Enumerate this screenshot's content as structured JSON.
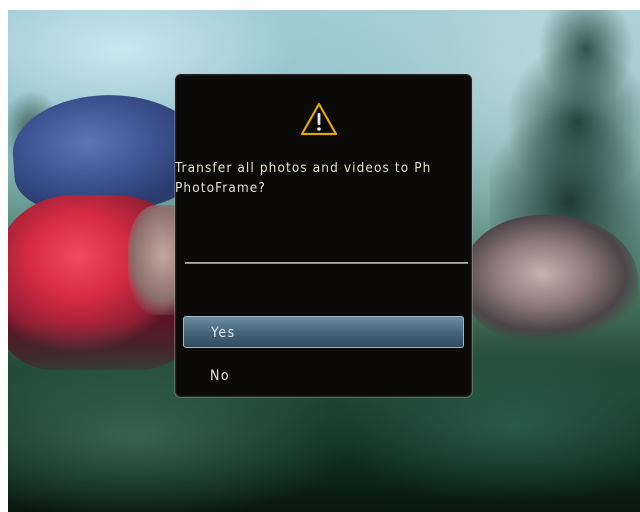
{
  "dialog": {
    "icon": "warning-icon",
    "message_line1": "Transfer all photos and videos to Ph",
    "message_line2": "PhotoFrame?",
    "options": [
      {
        "label": "Yes",
        "selected": true
      },
      {
        "label": "No",
        "selected": false
      }
    ]
  },
  "colors": {
    "dialog_background": "#0b0a09",
    "icon_accent": "#e0a51e",
    "selected_option": "#45657c",
    "text": "#e6e0d2"
  }
}
